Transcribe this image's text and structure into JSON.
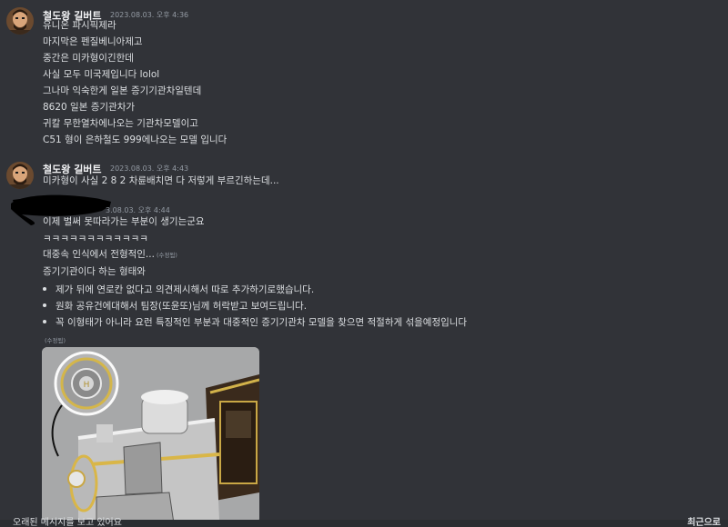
{
  "messages": [
    {
      "username": "철도왕 길버트",
      "timestamp": "2023.08.03. 오후 4:36",
      "lines": [
        "유니온 파시픽제라",
        "마지막은 펜질베니아제고",
        "중간은 미카형이긴한데",
        "사실 모두 미국제입니다 lolol",
        "그나마 익숙한게 일본 증기기관차일텐데",
        "8620 일본 증기관차가",
        "귀칼 무한열차에나오는 기관차모델이고",
        "C51 형이 은하철도 999에나오는 모델 입니다"
      ]
    },
    {
      "username": "철도왕 길버트",
      "timestamp": "2023.08.03. 오후 4:43",
      "lines": [
        "미카형이 사실 2 8 2 차륜배치면 다 저렇게 부르긴하는데..."
      ]
    },
    {
      "username": "",
      "timestamp": "3.08.03. 오후 4:44",
      "lines": [
        "이제 벌써 못따라가는 부분이 생기는군요",
        "ㅋㅋㅋㅋㅋㅋㅋㅋㅋㅋㅋㅋ",
        "대중속 인식에서 전형적인...",
        "증기기관이다 하는 형태와"
      ],
      "edited_label": "(수정됨)",
      "bullets": [
        "제가 뒤에 연로칸 없다고 의견제시해서 따로 추가하기로했습니다.",
        "원화 공유건에대해서 팀장(또윤또)님께 허락받고 보여드립니다.",
        "꼭 이형태가 아니라 요런 특징적인 부분과 대중적인 증기기관차 모델을 찾으면 적절하게 섞을예정입니다"
      ],
      "attachment_edited_label": "(수정됨)"
    }
  ],
  "footer": {
    "left_text": "오래된 메시지를 보고 있어요",
    "right_text": "최근으로"
  },
  "colors": {
    "background": "#313338",
    "text": "#dbdee1",
    "muted": "#949ba4",
    "username": "#f2f3f5"
  },
  "icons": {
    "avatar": "avatar",
    "attachment": "train-illustration"
  }
}
